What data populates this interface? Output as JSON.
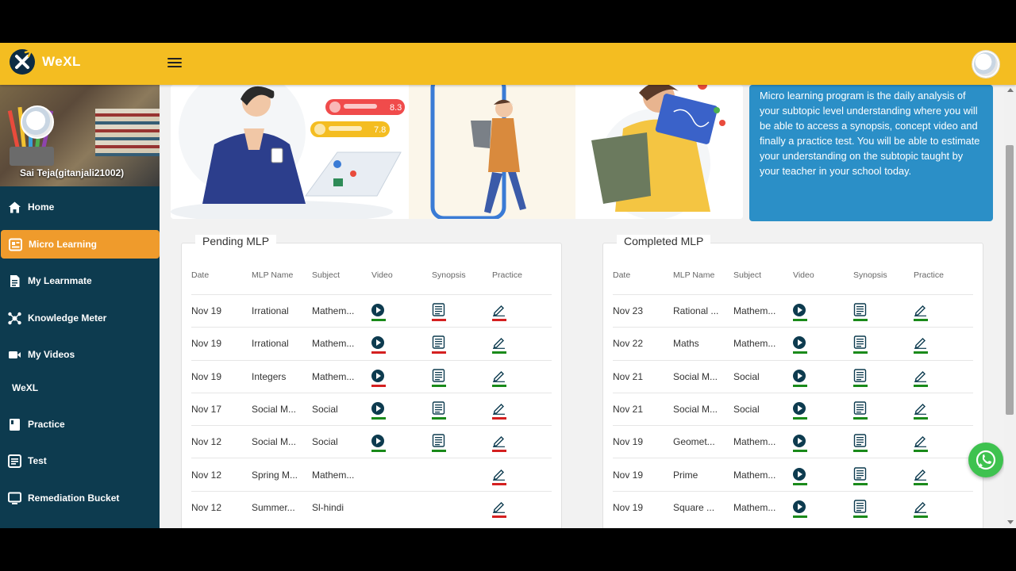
{
  "app": {
    "logo_text": "WeXL"
  },
  "sidebar": {
    "user_name": "Sai Teja(gitanjali21002)",
    "items": [
      {
        "label": "Home",
        "icon": "home-icon"
      },
      {
        "label": "Micro Learning",
        "icon": "dashboard-icon",
        "active": true
      },
      {
        "label": "My Learnmate",
        "icon": "document-icon"
      },
      {
        "label": "Knowledge Meter",
        "icon": "network-icon"
      },
      {
        "label": "My Videos",
        "icon": "video-camera-icon"
      }
    ],
    "section_label": "WeXL",
    "items2": [
      {
        "label": "Practice",
        "icon": "book-icon"
      },
      {
        "label": "Test",
        "icon": "list-icon"
      },
      {
        "label": "Remediation Bucket",
        "icon": "monitor-icon"
      }
    ]
  },
  "banner": {
    "score1": "8.3",
    "score2": "7.8"
  },
  "info": {
    "text": "Micro learning program is the daily analysis of your subtopic level understanding where you will be able to access a synopsis, concept video and finally a practice test. You will be able to estimate your understanding on the subtopic taught by your teacher in your school today."
  },
  "columns": [
    "Date",
    "MLP Name",
    "Subject",
    "Video",
    "Synopsis",
    "Practice"
  ],
  "colors": {
    "done": "#1a8a1a",
    "pending": "#d42020",
    "navy": "#0d3b4f",
    "accent": "#f4bd21"
  },
  "pending": {
    "title": "Pending MLP",
    "rows": [
      {
        "date": "Nov 19",
        "name": "Irrational",
        "subject": "Mathem...",
        "video": "green",
        "synopsis": "red",
        "practice": "red"
      },
      {
        "date": "Nov 19",
        "name": "Irrational",
        "subject": "Mathem...",
        "video": "red",
        "synopsis": "red",
        "practice": "green"
      },
      {
        "date": "Nov 19",
        "name": "Integers",
        "subject": "Mathem...",
        "video": "red",
        "synopsis": "green",
        "practice": "green"
      },
      {
        "date": "Nov 17",
        "name": "Social M...",
        "subject": "Social",
        "video": "green",
        "synopsis": "green",
        "practice": "red"
      },
      {
        "date": "Nov 12",
        "name": "Social M...",
        "subject": "Social",
        "video": "green",
        "synopsis": "green",
        "practice": "red"
      },
      {
        "date": "Nov 12",
        "name": "Spring M...",
        "subject": "Mathem...",
        "video": "",
        "synopsis": "",
        "practice": "red"
      },
      {
        "date": "Nov 12",
        "name": "Summer...",
        "subject": "Sl-hindi",
        "video": "",
        "synopsis": "",
        "practice": "red"
      }
    ]
  },
  "completed": {
    "title": "Completed MLP",
    "rows": [
      {
        "date": "Nov 23",
        "name": "Rational ...",
        "subject": "Mathem...",
        "video": "green",
        "synopsis": "green",
        "practice": "green"
      },
      {
        "date": "Nov 22",
        "name": "Maths",
        "subject": "Mathem...",
        "video": "green",
        "synopsis": "green",
        "practice": "green"
      },
      {
        "date": "Nov 21",
        "name": "Social M...",
        "subject": "Social",
        "video": "green",
        "synopsis": "green",
        "practice": "green"
      },
      {
        "date": "Nov 21",
        "name": "Social M...",
        "subject": "Social",
        "video": "green",
        "synopsis": "green",
        "practice": "green"
      },
      {
        "date": "Nov 19",
        "name": "Geomet...",
        "subject": "Mathem...",
        "video": "green",
        "synopsis": "green",
        "practice": "green"
      },
      {
        "date": "Nov 19",
        "name": "Prime",
        "subject": "Mathem...",
        "video": "green",
        "synopsis": "green",
        "practice": "green"
      },
      {
        "date": "Nov 19",
        "name": "Square ...",
        "subject": "Mathem...",
        "video": "green",
        "synopsis": "green",
        "practice": "green"
      }
    ]
  }
}
